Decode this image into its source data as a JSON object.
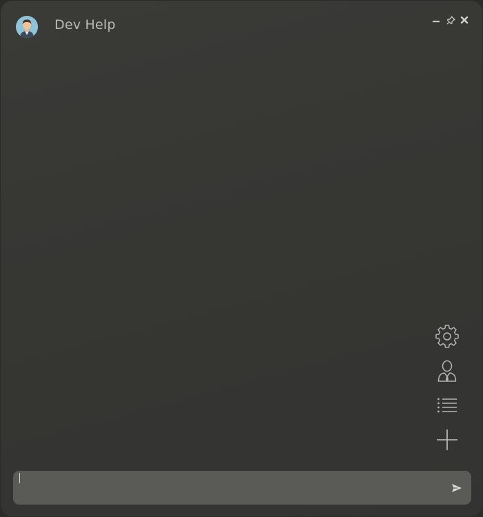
{
  "window": {
    "title": "Dev Help",
    "controls": [
      "minimize-icon",
      "pin-icon",
      "close-icon"
    ]
  },
  "sidebar_tools": [
    {
      "name": "settings",
      "icon": "gear-icon"
    },
    {
      "name": "persona",
      "icon": "user-icon"
    },
    {
      "name": "history",
      "icon": "list-icon"
    },
    {
      "name": "new-chat",
      "icon": "plus-icon"
    }
  ],
  "composer": {
    "value": "",
    "placeholder": "",
    "send_icon": "send-icon"
  },
  "colors": {
    "background": "#363633",
    "composer": "#5a5a57",
    "icon": "#b5b5b1",
    "title_text": "#b8b8b4"
  }
}
